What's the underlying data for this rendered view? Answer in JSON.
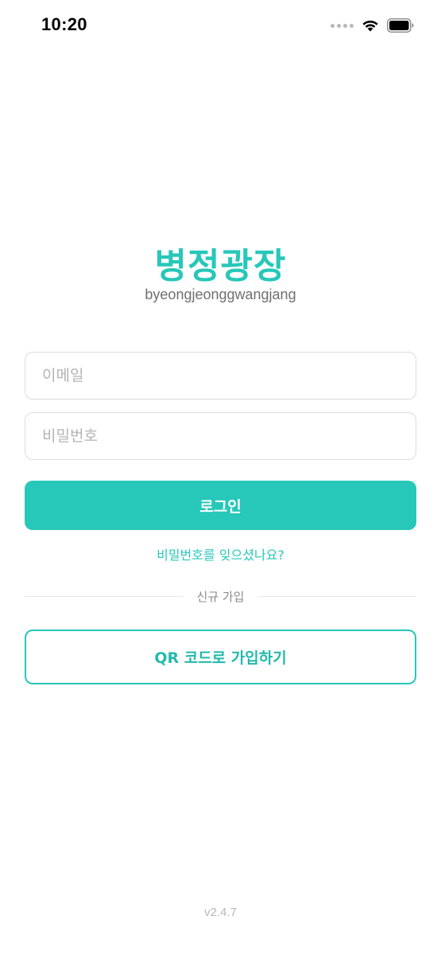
{
  "status_bar": {
    "time": "10:20",
    "icons": [
      "signal-dots-icon",
      "wifi-icon",
      "battery-icon"
    ]
  },
  "brand": {
    "title": "병정광장",
    "subtitle": "byeongjeonggwangjang"
  },
  "login_form": {
    "email": {
      "value": "",
      "placeholder": "이메일"
    },
    "password": {
      "value": "",
      "placeholder": "비밀번호"
    },
    "login_label": "로그인",
    "forgot_password_label": "비밀번호를 잊으셨나요?"
  },
  "signup": {
    "divider_label": "신규 가입",
    "qr_signup_label": "QR 코드로 가입하기"
  },
  "footer": {
    "version": "v2.4.7"
  },
  "colors": {
    "accent": "#27c7b9",
    "border": "#dcdcdc",
    "placeholder": "#b3b3b3",
    "muted_text": "#8a8a8a"
  }
}
